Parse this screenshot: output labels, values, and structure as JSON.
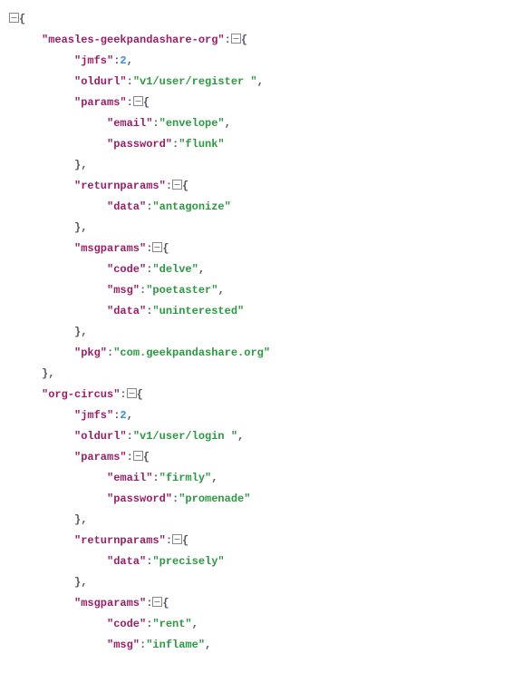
{
  "lines": [
    {
      "indent": 0,
      "tokens": [
        {
          "type": "toggle"
        },
        {
          "type": "punct",
          "v": "{"
        }
      ]
    },
    {
      "indent": 1,
      "tokens": [
        {
          "type": "key",
          "v": "\"measles-geekpandashare-org\""
        },
        {
          "type": "punct",
          "v": ":"
        },
        {
          "type": "toggle"
        },
        {
          "type": "punct",
          "v": "{"
        }
      ]
    },
    {
      "indent": 2,
      "tokens": [
        {
          "type": "key",
          "v": "\"jmfs\""
        },
        {
          "type": "punct",
          "v": ":"
        },
        {
          "type": "num",
          "v": "2"
        },
        {
          "type": "punct",
          "v": ","
        }
      ]
    },
    {
      "indent": 2,
      "tokens": [
        {
          "type": "key",
          "v": "\"oldurl\""
        },
        {
          "type": "punct",
          "v": ":"
        },
        {
          "type": "str",
          "v": "\"v1/user/register \""
        },
        {
          "type": "punct",
          "v": ","
        }
      ]
    },
    {
      "indent": 2,
      "tokens": [
        {
          "type": "key",
          "v": "\"params\""
        },
        {
          "type": "punct",
          "v": ":"
        },
        {
          "type": "toggle"
        },
        {
          "type": "punct",
          "v": "{"
        }
      ]
    },
    {
      "indent": 3,
      "tokens": [
        {
          "type": "key",
          "v": "\"email\""
        },
        {
          "type": "punct",
          "v": ":"
        },
        {
          "type": "str",
          "v": "\"envelope\""
        },
        {
          "type": "punct",
          "v": ","
        }
      ]
    },
    {
      "indent": 3,
      "tokens": [
        {
          "type": "key",
          "v": "\"password\""
        },
        {
          "type": "punct",
          "v": ":"
        },
        {
          "type": "str",
          "v": "\"flunk\""
        }
      ]
    },
    {
      "indent": 2,
      "tokens": [
        {
          "type": "punct",
          "v": "},"
        }
      ]
    },
    {
      "indent": 2,
      "tokens": [
        {
          "type": "key",
          "v": "\"returnparams\""
        },
        {
          "type": "punct",
          "v": ":"
        },
        {
          "type": "toggle"
        },
        {
          "type": "punct",
          "v": "{"
        }
      ]
    },
    {
      "indent": 3,
      "tokens": [
        {
          "type": "key",
          "v": "\"data\""
        },
        {
          "type": "punct",
          "v": ":"
        },
        {
          "type": "str",
          "v": "\"antagonize\""
        }
      ]
    },
    {
      "indent": 2,
      "tokens": [
        {
          "type": "punct",
          "v": "},"
        }
      ]
    },
    {
      "indent": 2,
      "tokens": [
        {
          "type": "key",
          "v": "\"msgparams\""
        },
        {
          "type": "punct",
          "v": ":"
        },
        {
          "type": "toggle"
        },
        {
          "type": "punct",
          "v": "{"
        }
      ]
    },
    {
      "indent": 3,
      "tokens": [
        {
          "type": "key",
          "v": "\"code\""
        },
        {
          "type": "punct",
          "v": ":"
        },
        {
          "type": "str",
          "v": "\"delve\""
        },
        {
          "type": "punct",
          "v": ","
        }
      ]
    },
    {
      "indent": 3,
      "tokens": [
        {
          "type": "key",
          "v": "\"msg\""
        },
        {
          "type": "punct",
          "v": ":"
        },
        {
          "type": "str",
          "v": "\"poetaster\""
        },
        {
          "type": "punct",
          "v": ","
        }
      ]
    },
    {
      "indent": 3,
      "tokens": [
        {
          "type": "key",
          "v": "\"data\""
        },
        {
          "type": "punct",
          "v": ":"
        },
        {
          "type": "str",
          "v": "\"uninterested\""
        }
      ]
    },
    {
      "indent": 2,
      "tokens": [
        {
          "type": "punct",
          "v": "},"
        }
      ]
    },
    {
      "indent": 2,
      "tokens": [
        {
          "type": "key",
          "v": "\"pkg\""
        },
        {
          "type": "punct",
          "v": ":"
        },
        {
          "type": "str",
          "v": "\"com.geekpandashare.org\""
        }
      ]
    },
    {
      "indent": 1,
      "tokens": [
        {
          "type": "punct",
          "v": "},"
        }
      ]
    },
    {
      "indent": 1,
      "tokens": [
        {
          "type": "key",
          "v": "\"org-circus\""
        },
        {
          "type": "punct",
          "v": ":"
        },
        {
          "type": "toggle"
        },
        {
          "type": "punct",
          "v": "{"
        }
      ]
    },
    {
      "indent": 2,
      "tokens": [
        {
          "type": "key",
          "v": "\"jmfs\""
        },
        {
          "type": "punct",
          "v": ":"
        },
        {
          "type": "num",
          "v": "2"
        },
        {
          "type": "punct",
          "v": ","
        }
      ]
    },
    {
      "indent": 2,
      "tokens": [
        {
          "type": "key",
          "v": "\"oldurl\""
        },
        {
          "type": "punct",
          "v": ":"
        },
        {
          "type": "str",
          "v": "\"v1/user/login \""
        },
        {
          "type": "punct",
          "v": ","
        }
      ]
    },
    {
      "indent": 2,
      "tokens": [
        {
          "type": "key",
          "v": "\"params\""
        },
        {
          "type": "punct",
          "v": ":"
        },
        {
          "type": "toggle"
        },
        {
          "type": "punct",
          "v": "{"
        }
      ]
    },
    {
      "indent": 3,
      "tokens": [
        {
          "type": "key",
          "v": "\"email\""
        },
        {
          "type": "punct",
          "v": ":"
        },
        {
          "type": "str",
          "v": "\"firmly\""
        },
        {
          "type": "punct",
          "v": ","
        }
      ]
    },
    {
      "indent": 3,
      "tokens": [
        {
          "type": "key",
          "v": "\"password\""
        },
        {
          "type": "punct",
          "v": ":"
        },
        {
          "type": "str",
          "v": "\"promenade\""
        }
      ]
    },
    {
      "indent": 2,
      "tokens": [
        {
          "type": "punct",
          "v": "},"
        }
      ]
    },
    {
      "indent": 2,
      "tokens": [
        {
          "type": "key",
          "v": "\"returnparams\""
        },
        {
          "type": "punct",
          "v": ":"
        },
        {
          "type": "toggle"
        },
        {
          "type": "punct",
          "v": "{"
        }
      ]
    },
    {
      "indent": 3,
      "tokens": [
        {
          "type": "key",
          "v": "\"data\""
        },
        {
          "type": "punct",
          "v": ":"
        },
        {
          "type": "str",
          "v": "\"precisely\""
        }
      ]
    },
    {
      "indent": 2,
      "tokens": [
        {
          "type": "punct",
          "v": "},"
        }
      ]
    },
    {
      "indent": 2,
      "tokens": [
        {
          "type": "key",
          "v": "\"msgparams\""
        },
        {
          "type": "punct",
          "v": ":"
        },
        {
          "type": "toggle"
        },
        {
          "type": "punct",
          "v": "{"
        }
      ]
    },
    {
      "indent": 3,
      "tokens": [
        {
          "type": "key",
          "v": "\"code\""
        },
        {
          "type": "punct",
          "v": ":"
        },
        {
          "type": "str",
          "v": "\"rent\""
        },
        {
          "type": "punct",
          "v": ","
        }
      ]
    },
    {
      "indent": 3,
      "tokens": [
        {
          "type": "key",
          "v": "\"msg\""
        },
        {
          "type": "punct",
          "v": ":"
        },
        {
          "type": "str",
          "v": "\"inflame\""
        },
        {
          "type": "punct",
          "v": ","
        }
      ]
    }
  ]
}
